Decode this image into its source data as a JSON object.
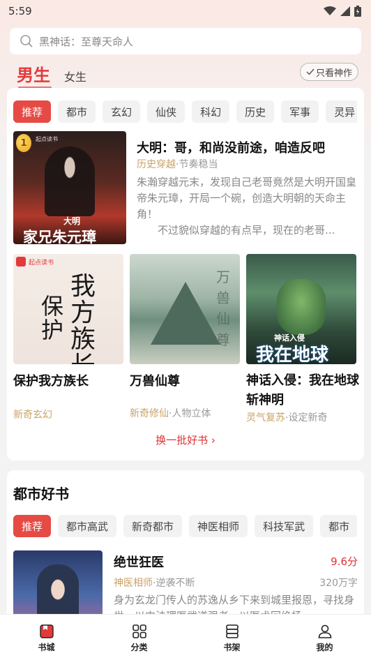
{
  "status": {
    "time": "5:59"
  },
  "search": {
    "placeholder": "黑神话：至尊天命人"
  },
  "gender": {
    "male": "男生",
    "female": "女生"
  },
  "filter": {
    "only_god": "只看神作"
  },
  "categories": [
    "推荐",
    "都市",
    "玄幻",
    "仙侠",
    "科幻",
    "历史",
    "军事",
    "灵异"
  ],
  "featured": {
    "rank": "1",
    "cover_publisher": "起点读书",
    "cover_text_top": "大明",
    "cover_text_main": "家兄朱元璋",
    "title": "大明：哥，和尚没前途，咱造反吧",
    "tag": "历史穿越",
    "meta": "·节奏稳当",
    "desc": "朱瀚穿越元末，发现自己老哥竟然是大明开国皇帝朱元璋，开局一个碗，创造大明朝的天命主角！\n　　不过貌似穿越的有点早，现在的老哥..."
  },
  "grid_books": [
    {
      "cover_publisher": "起点读书",
      "cover_text": "我方族长",
      "cover_text2": "保护",
      "title": "保护我方族长",
      "tag": "新奇玄幻",
      "meta": ""
    },
    {
      "cover_text": "万兽仙尊",
      "title": "万兽仙尊",
      "tag": "新奇修仙",
      "meta": "·人物立体"
    },
    {
      "cover_text": "我在地球",
      "cover_text2": "神话入侵",
      "title": "神话入侵：我在地球斩神明",
      "tag": "灵气复苏",
      "meta": "·设定新奇"
    }
  ],
  "refresh": "换一批好书",
  "section2": {
    "title": "都市好书",
    "chips": [
      "推荐",
      "都市高武",
      "新奇都市",
      "神医相师",
      "科技军武",
      "都市"
    ],
    "book": {
      "title": "绝世狂医",
      "score": "9.6分",
      "tag": "神医相师",
      "meta": "·逆袭不断",
      "count": "320万字",
      "desc": "身为玄龙门传人的苏逸从乡下来到城里报恩，寻找身世，以中法理医武道强者，以医术回绝扬"
    }
  },
  "nav": [
    "书城",
    "分类",
    "书架",
    "我的"
  ],
  "colors": {
    "accent": "#e23a3a",
    "gold_tag": "#c9a368"
  }
}
